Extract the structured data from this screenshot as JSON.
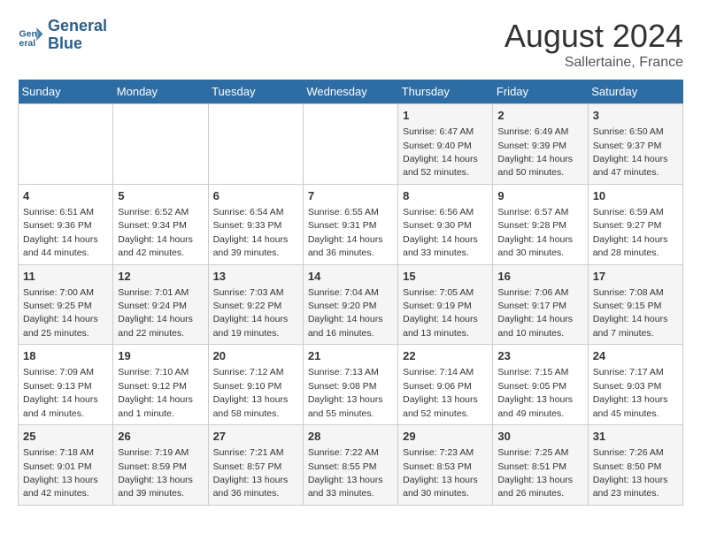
{
  "header": {
    "logo_line1": "General",
    "logo_line2": "Blue",
    "month_year": "August 2024",
    "location": "Sallertaine, France"
  },
  "weekdays": [
    "Sunday",
    "Monday",
    "Tuesday",
    "Wednesday",
    "Thursday",
    "Friday",
    "Saturday"
  ],
  "weeks": [
    [
      {
        "day": "",
        "info": ""
      },
      {
        "day": "",
        "info": ""
      },
      {
        "day": "",
        "info": ""
      },
      {
        "day": "",
        "info": ""
      },
      {
        "day": "1",
        "info": "Sunrise: 6:47 AM\nSunset: 9:40 PM\nDaylight: 14 hours\nand 52 minutes."
      },
      {
        "day": "2",
        "info": "Sunrise: 6:49 AM\nSunset: 9:39 PM\nDaylight: 14 hours\nand 50 minutes."
      },
      {
        "day": "3",
        "info": "Sunrise: 6:50 AM\nSunset: 9:37 PM\nDaylight: 14 hours\nand 47 minutes."
      }
    ],
    [
      {
        "day": "4",
        "info": "Sunrise: 6:51 AM\nSunset: 9:36 PM\nDaylight: 14 hours\nand 44 minutes."
      },
      {
        "day": "5",
        "info": "Sunrise: 6:52 AM\nSunset: 9:34 PM\nDaylight: 14 hours\nand 42 minutes."
      },
      {
        "day": "6",
        "info": "Sunrise: 6:54 AM\nSunset: 9:33 PM\nDaylight: 14 hours\nand 39 minutes."
      },
      {
        "day": "7",
        "info": "Sunrise: 6:55 AM\nSunset: 9:31 PM\nDaylight: 14 hours\nand 36 minutes."
      },
      {
        "day": "8",
        "info": "Sunrise: 6:56 AM\nSunset: 9:30 PM\nDaylight: 14 hours\nand 33 minutes."
      },
      {
        "day": "9",
        "info": "Sunrise: 6:57 AM\nSunset: 9:28 PM\nDaylight: 14 hours\nand 30 minutes."
      },
      {
        "day": "10",
        "info": "Sunrise: 6:59 AM\nSunset: 9:27 PM\nDaylight: 14 hours\nand 28 minutes."
      }
    ],
    [
      {
        "day": "11",
        "info": "Sunrise: 7:00 AM\nSunset: 9:25 PM\nDaylight: 14 hours\nand 25 minutes."
      },
      {
        "day": "12",
        "info": "Sunrise: 7:01 AM\nSunset: 9:24 PM\nDaylight: 14 hours\nand 22 minutes."
      },
      {
        "day": "13",
        "info": "Sunrise: 7:03 AM\nSunset: 9:22 PM\nDaylight: 14 hours\nand 19 minutes."
      },
      {
        "day": "14",
        "info": "Sunrise: 7:04 AM\nSunset: 9:20 PM\nDaylight: 14 hours\nand 16 minutes."
      },
      {
        "day": "15",
        "info": "Sunrise: 7:05 AM\nSunset: 9:19 PM\nDaylight: 14 hours\nand 13 minutes."
      },
      {
        "day": "16",
        "info": "Sunrise: 7:06 AM\nSunset: 9:17 PM\nDaylight: 14 hours\nand 10 minutes."
      },
      {
        "day": "17",
        "info": "Sunrise: 7:08 AM\nSunset: 9:15 PM\nDaylight: 14 hours\nand 7 minutes."
      }
    ],
    [
      {
        "day": "18",
        "info": "Sunrise: 7:09 AM\nSunset: 9:13 PM\nDaylight: 14 hours\nand 4 minutes."
      },
      {
        "day": "19",
        "info": "Sunrise: 7:10 AM\nSunset: 9:12 PM\nDaylight: 14 hours\nand 1 minute."
      },
      {
        "day": "20",
        "info": "Sunrise: 7:12 AM\nSunset: 9:10 PM\nDaylight: 13 hours\nand 58 minutes."
      },
      {
        "day": "21",
        "info": "Sunrise: 7:13 AM\nSunset: 9:08 PM\nDaylight: 13 hours\nand 55 minutes."
      },
      {
        "day": "22",
        "info": "Sunrise: 7:14 AM\nSunset: 9:06 PM\nDaylight: 13 hours\nand 52 minutes."
      },
      {
        "day": "23",
        "info": "Sunrise: 7:15 AM\nSunset: 9:05 PM\nDaylight: 13 hours\nand 49 minutes."
      },
      {
        "day": "24",
        "info": "Sunrise: 7:17 AM\nSunset: 9:03 PM\nDaylight: 13 hours\nand 45 minutes."
      }
    ],
    [
      {
        "day": "25",
        "info": "Sunrise: 7:18 AM\nSunset: 9:01 PM\nDaylight: 13 hours\nand 42 minutes."
      },
      {
        "day": "26",
        "info": "Sunrise: 7:19 AM\nSunset: 8:59 PM\nDaylight: 13 hours\nand 39 minutes."
      },
      {
        "day": "27",
        "info": "Sunrise: 7:21 AM\nSunset: 8:57 PM\nDaylight: 13 hours\nand 36 minutes."
      },
      {
        "day": "28",
        "info": "Sunrise: 7:22 AM\nSunset: 8:55 PM\nDaylight: 13 hours\nand 33 minutes."
      },
      {
        "day": "29",
        "info": "Sunrise: 7:23 AM\nSunset: 8:53 PM\nDaylight: 13 hours\nand 30 minutes."
      },
      {
        "day": "30",
        "info": "Sunrise: 7:25 AM\nSunset: 8:51 PM\nDaylight: 13 hours\nand 26 minutes."
      },
      {
        "day": "31",
        "info": "Sunrise: 7:26 AM\nSunset: 8:50 PM\nDaylight: 13 hours\nand 23 minutes."
      }
    ]
  ]
}
